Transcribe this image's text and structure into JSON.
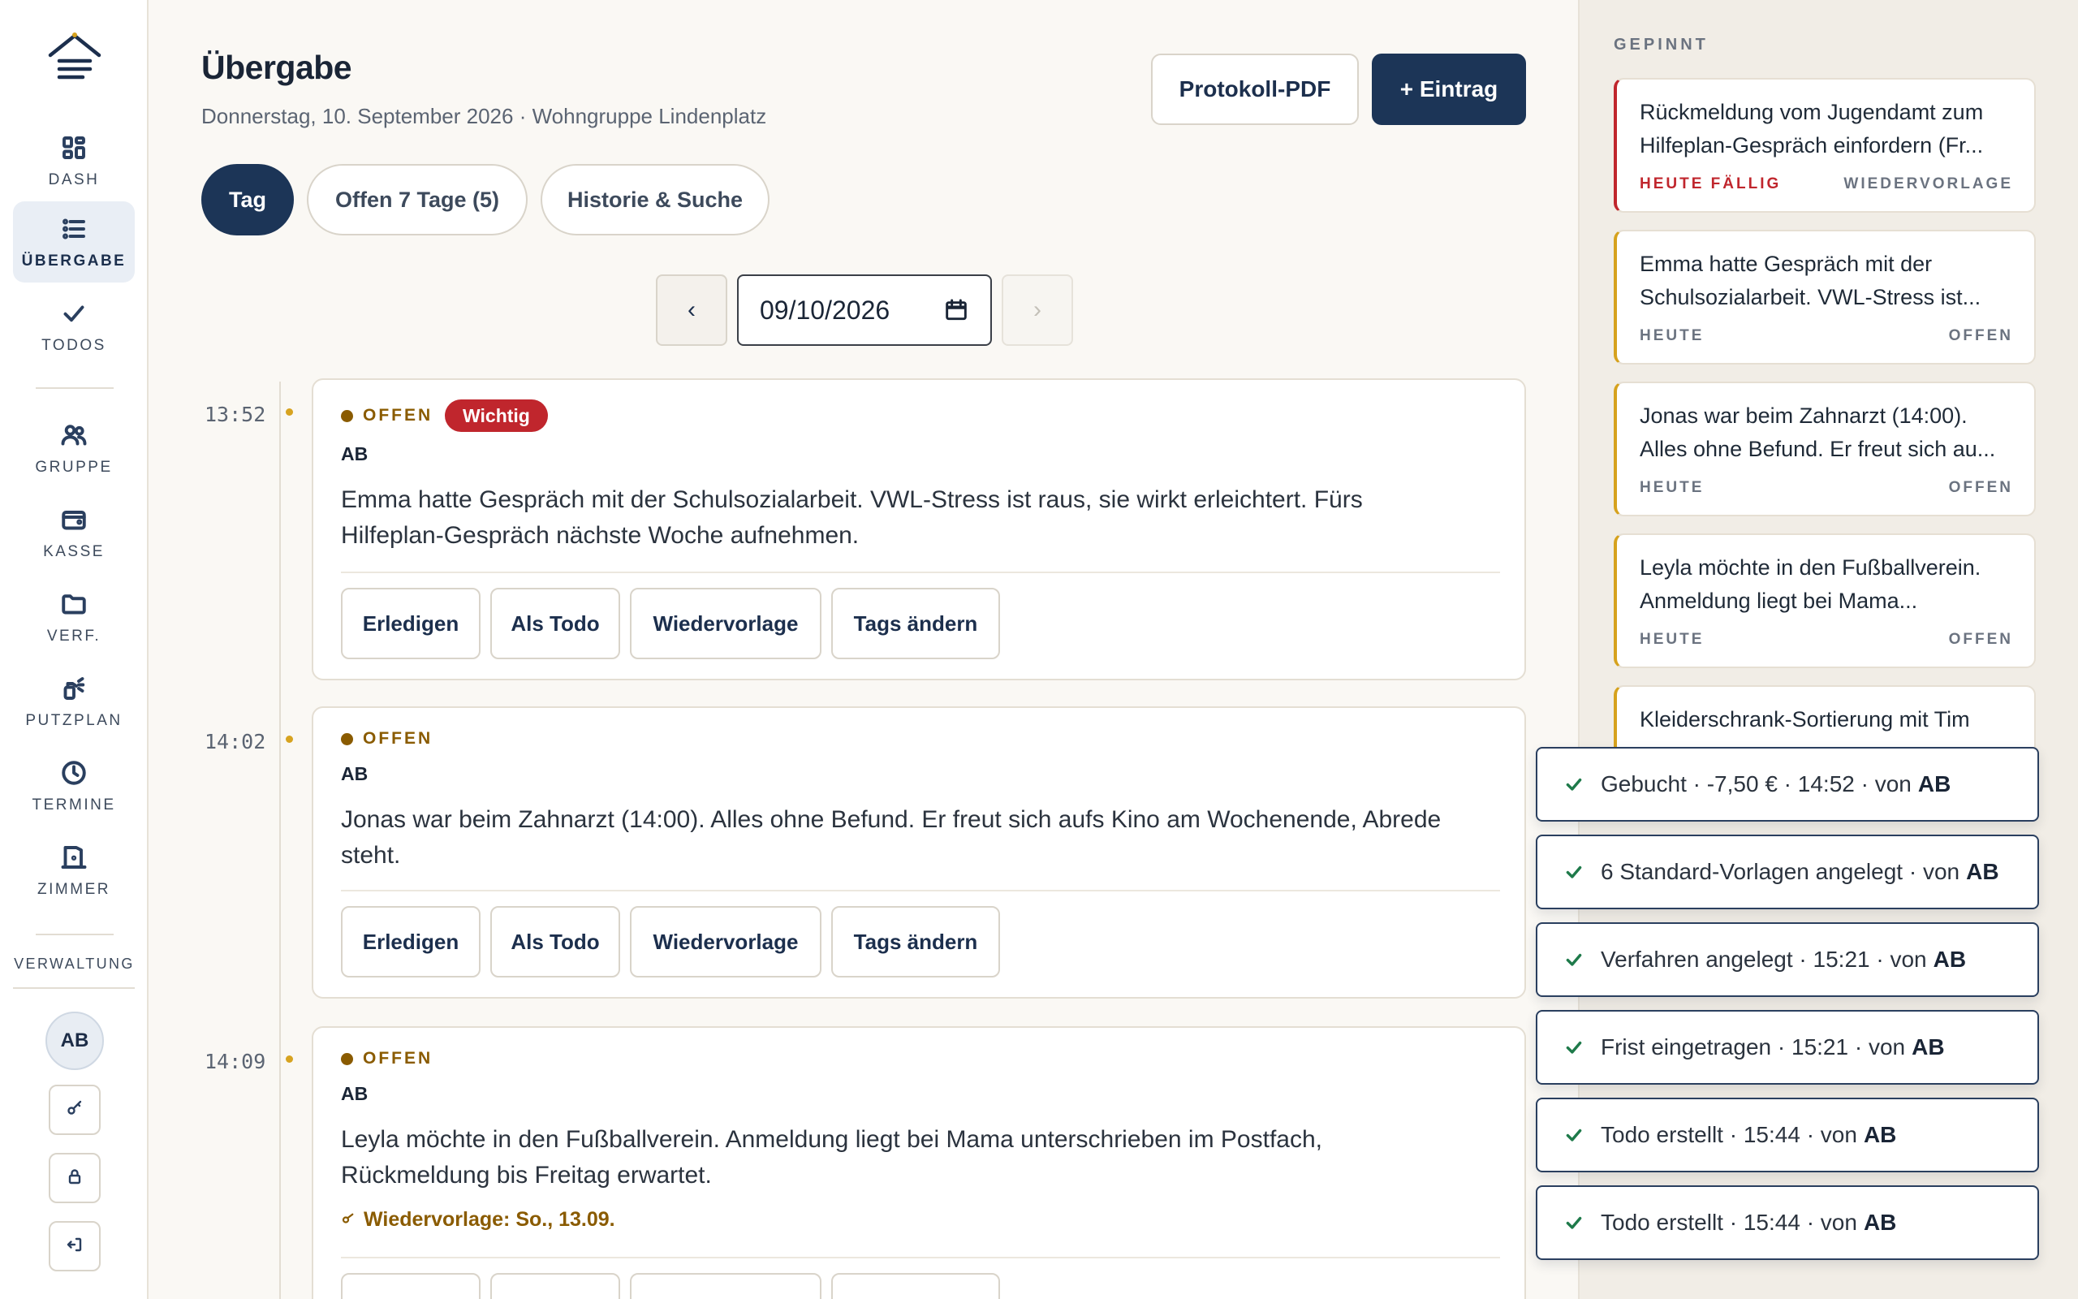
{
  "sidebar": {
    "nav": [
      {
        "label": "DASH",
        "icon": "grid-icon"
      },
      {
        "label": "ÜBERGABE",
        "icon": "list-icon",
        "active": true
      },
      {
        "label": "TODOS",
        "icon": "check-icon"
      },
      {
        "label": "GRUPPE",
        "icon": "users-icon"
      },
      {
        "label": "KASSE",
        "icon": "wallet-icon"
      },
      {
        "label": "VERF.",
        "icon": "folder-icon"
      },
      {
        "label": "PUTZPLAN",
        "icon": "spray-icon"
      },
      {
        "label": "TERMINE",
        "icon": "clock-icon"
      },
      {
        "label": "ZIMMER",
        "icon": "door-icon"
      }
    ],
    "section_label": "VERWALTUNG",
    "avatar_initials": "AB"
  },
  "header": {
    "title": "Übergabe",
    "subtitle": "Donnerstag, 10. September 2026 · Wohngruppe Lindenplatz",
    "pdf_button": "Protokoll-PDF",
    "add_button": "+ Eintrag"
  },
  "tabs": [
    "Tag",
    "Offen 7 Tage (5)",
    "Historie & Suche"
  ],
  "date_picker": {
    "value": "09/10/2026",
    "prev": "‹",
    "next": "›"
  },
  "entries": [
    {
      "time": "13:52",
      "status": "OFFEN",
      "badge": "Wichtig",
      "author": "AB",
      "text_lines": [
        "Emma hatte Gespräch mit der Schulsozialarbeit. VWL-Stress ist raus, sie wirkt erleichtert. Fürs",
        "Hilfeplan-Gespräch nächste Woche aufnehmen."
      ],
      "actions": [
        "Erledigen",
        "Als Todo",
        "Wiedervorlage",
        "Tags ändern"
      ]
    },
    {
      "time": "14:02",
      "status": "OFFEN",
      "author": "AB",
      "text_lines": [
        "Jonas war beim Zahnarzt (14:00). Alles ohne Befund. Er freut sich aufs Kino am Wochenende, Abrede",
        "steht."
      ],
      "actions": [
        "Erledigen",
        "Als Todo",
        "Wiedervorlage",
        "Tags ändern"
      ]
    },
    {
      "time": "14:09",
      "status": "OFFEN",
      "author": "AB",
      "text_lines": [
        "Leyla möchte in den Fußballverein. Anmeldung liegt bei Mama unterschrieben im Postfach,",
        "Rückmeldung bis Freitag erwartet."
      ],
      "follow_up": "Wiedervorlage: So., 13.09."
    }
  ],
  "pinned": {
    "title": "GEPINNT",
    "cards": [
      {
        "lines": [
          "Rückmeldung vom Jugendamt zum",
          "Hilfeplan-Gespräch einfordern (Fr..."
        ],
        "left": "HEUTE FÄLLIG",
        "right": "WIEDERVORLAGE",
        "urgent": true
      },
      {
        "lines": [
          "Emma hatte Gespräch mit der",
          "Schulsozialarbeit. VWL-Stress ist..."
        ],
        "left": "HEUTE",
        "right": "OFFEN"
      },
      {
        "lines": [
          "Jonas war beim Zahnarzt (14:00).",
          "Alles ohne Befund. Er freut sich au..."
        ],
        "left": "HEUTE",
        "right": "OFFEN"
      },
      {
        "lines": [
          "Leyla möchte in den Fußballverein.",
          "Anmeldung liegt bei Mama..."
        ],
        "left": "HEUTE",
        "right": "OFFEN"
      },
      {
        "lines": [
          "Kleiderschrank-Sortierung mit Tim",
          ""
        ],
        "left": "",
        "right": ""
      }
    ]
  },
  "toasts": [
    {
      "text": "Gebucht · -7,50 € · 14:52 · von",
      "by": "AB"
    },
    {
      "text": "6 Standard-Vorlagen angelegt · von",
      "by": "AB"
    },
    {
      "text": "Verfahren angelegt · 15:21 · von",
      "by": "AB"
    },
    {
      "text": "Frist eingetragen · 15:21 · von",
      "by": "AB"
    },
    {
      "text": "Todo erstellt · 15:44 · von",
      "by": "AB"
    },
    {
      "text": "Todo erstellt · 15:44 · von",
      "by": "AB"
    }
  ],
  "colors": {
    "primary": "#1c3557",
    "accent": "#d6a21e",
    "danger": "#c0262d",
    "status": "#8a5b00",
    "success": "#1e7a4a"
  }
}
